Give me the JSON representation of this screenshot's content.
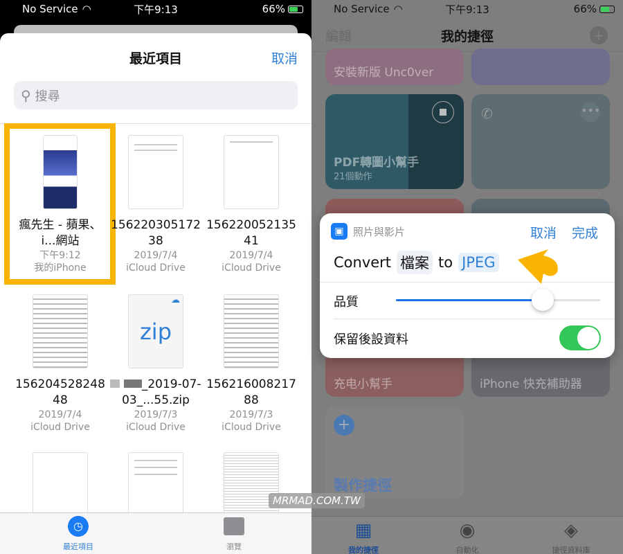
{
  "status": {
    "carrier": "No Service",
    "time": "下午9:13",
    "battery": "66%"
  },
  "files": {
    "title": "最近項目",
    "cancel": "取消",
    "search_placeholder": "搜尋",
    "items": [
      {
        "name": "瘋先生 - 蘋果、i...網站",
        "date": "下午9:12",
        "location": "我的iPhone",
        "selected": true
      },
      {
        "name": "15622030517238",
        "date": "2019/7/4",
        "location": "iCloud Drive"
      },
      {
        "name": "15622005213541",
        "date": "2019/7/4",
        "location": "iCloud Drive"
      },
      {
        "name": "15620452824848",
        "date": "2019/7/4",
        "location": "iCloud Drive"
      },
      {
        "name": "_2019-07-03_...55.zip",
        "date": "2019/7/3",
        "location": "iCloud Drive",
        "thumb_text": "zip"
      },
      {
        "name": "15621600821788",
        "date": "2019/7/3",
        "location": "iCloud Drive"
      }
    ],
    "tabs": [
      {
        "label": "最近項目",
        "active": true
      },
      {
        "label": "瀏覽"
      }
    ],
    "highlight_color": "#f8b400"
  },
  "shortcuts": {
    "edit": "編輯",
    "title": "我的捷徑",
    "cards": {
      "uncover": "安裝新版 Unc0ver",
      "pdf": "PDF轉圖小幫手",
      "pdf_sub": "21個動作",
      "charge": "充电小幫手",
      "fast": "iPhone 快充補助器",
      "create": "製作捷徑"
    },
    "tabs": [
      {
        "label": "我的捷徑",
        "active": true
      },
      {
        "label": "自動化"
      },
      {
        "label": "捷徑資料庫"
      }
    ]
  },
  "dialog": {
    "app": "照片與影片",
    "cancel": "取消",
    "done": "完成",
    "convert": "Convert",
    "input": "檔案",
    "to": "to",
    "format": "JPEG",
    "quality_label": "品質",
    "quality_value": 0.72,
    "preserve_label": "保留後設資料",
    "preserve_on": true
  },
  "watermark": "MRMAD.COM.TW"
}
